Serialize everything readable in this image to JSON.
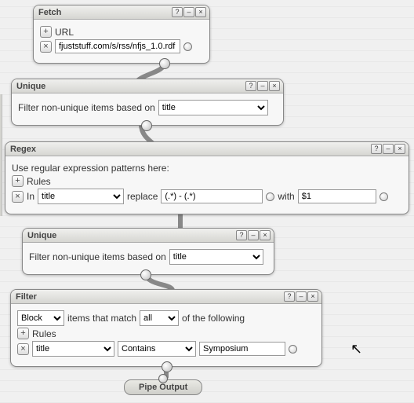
{
  "nodes": {
    "fetch": {
      "title": "Fetch",
      "url_label": "URL",
      "url_value": "fjuststuff.com/s/rss/nfjs_1.0.rdf"
    },
    "unique1": {
      "title": "Unique",
      "filter_label_pre": "Filter non-unique items based on",
      "field": "title"
    },
    "regex": {
      "title": "Regex",
      "intro": "Use regular expression patterns here:",
      "rules_label": "Rules",
      "in_label": "In",
      "in_field": "title",
      "replace_label": "replace",
      "replace_value": "(.*) - (.*)",
      "with_label": "with",
      "with_value": "$1"
    },
    "unique2": {
      "title": "Unique",
      "filter_label_pre": "Filter non-unique items based on",
      "field": "title"
    },
    "filter": {
      "title": "Filter",
      "mode": "Block",
      "items_label": "items that match",
      "match": "all",
      "following_label": "of the following",
      "rules_label": "Rules",
      "field": "title",
      "operator": "Contains",
      "value": "Symposium"
    }
  },
  "output_label": "Pipe Output",
  "buttons": {
    "help": "?",
    "minimize": "–",
    "close": "×",
    "add": "+",
    "remove": "×"
  }
}
